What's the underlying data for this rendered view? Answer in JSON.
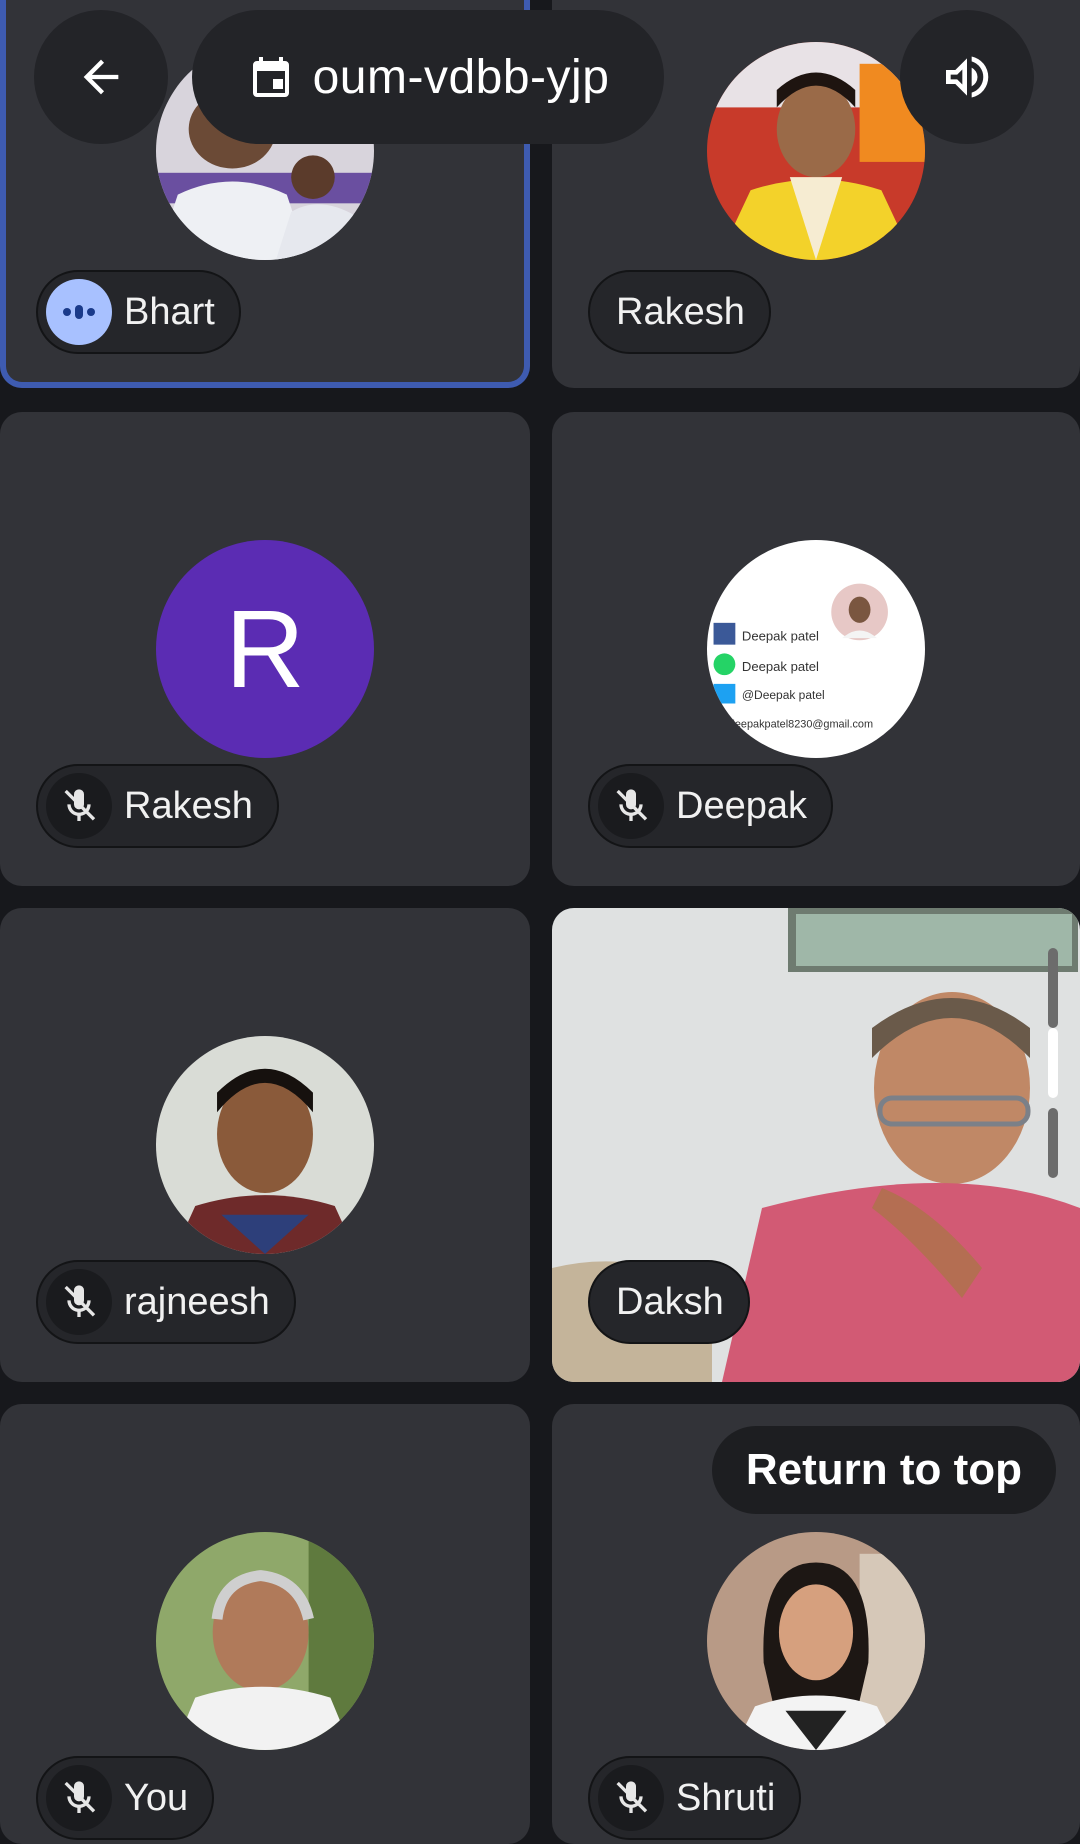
{
  "top_bar": {
    "meeting_code": "oum-vdbb-yjp",
    "back_icon": "arrow-left-icon",
    "calendar_icon": "calendar-icon",
    "audio_icon": "speaker-icon"
  },
  "participants": [
    {
      "name": "Bhart",
      "state": "speaking",
      "avatar": "photo"
    },
    {
      "name": "Rakesh",
      "state": "unmuted",
      "avatar": "photo"
    },
    {
      "name": "Rakesh",
      "state": "muted",
      "avatar": "letter",
      "initial": "R",
      "color": "#5b2cb3"
    },
    {
      "name": "Deepak",
      "state": "muted",
      "avatar": "photo"
    },
    {
      "name": "rajneesh",
      "state": "muted",
      "avatar": "photo"
    },
    {
      "name": "Daksh",
      "state": "video",
      "avatar": "camera-video"
    },
    {
      "name": "You",
      "state": "muted",
      "avatar": "photo"
    },
    {
      "name": "Shruti",
      "state": "muted",
      "avatar": "photo"
    }
  ],
  "deepak_card": {
    "line1": "Deepak patel",
    "line2": "Deepak patel",
    "line3": "@Deepak patel",
    "line4": "deepakpatel8230@gmail.com"
  },
  "return_to_top": "Return to top",
  "colors": {
    "background": "#17181c",
    "tile": "#323338",
    "active_border": "#3e5bb0",
    "speaking_indicator": "#a8c1ff",
    "letter_avatar": "#5b2cb3"
  }
}
